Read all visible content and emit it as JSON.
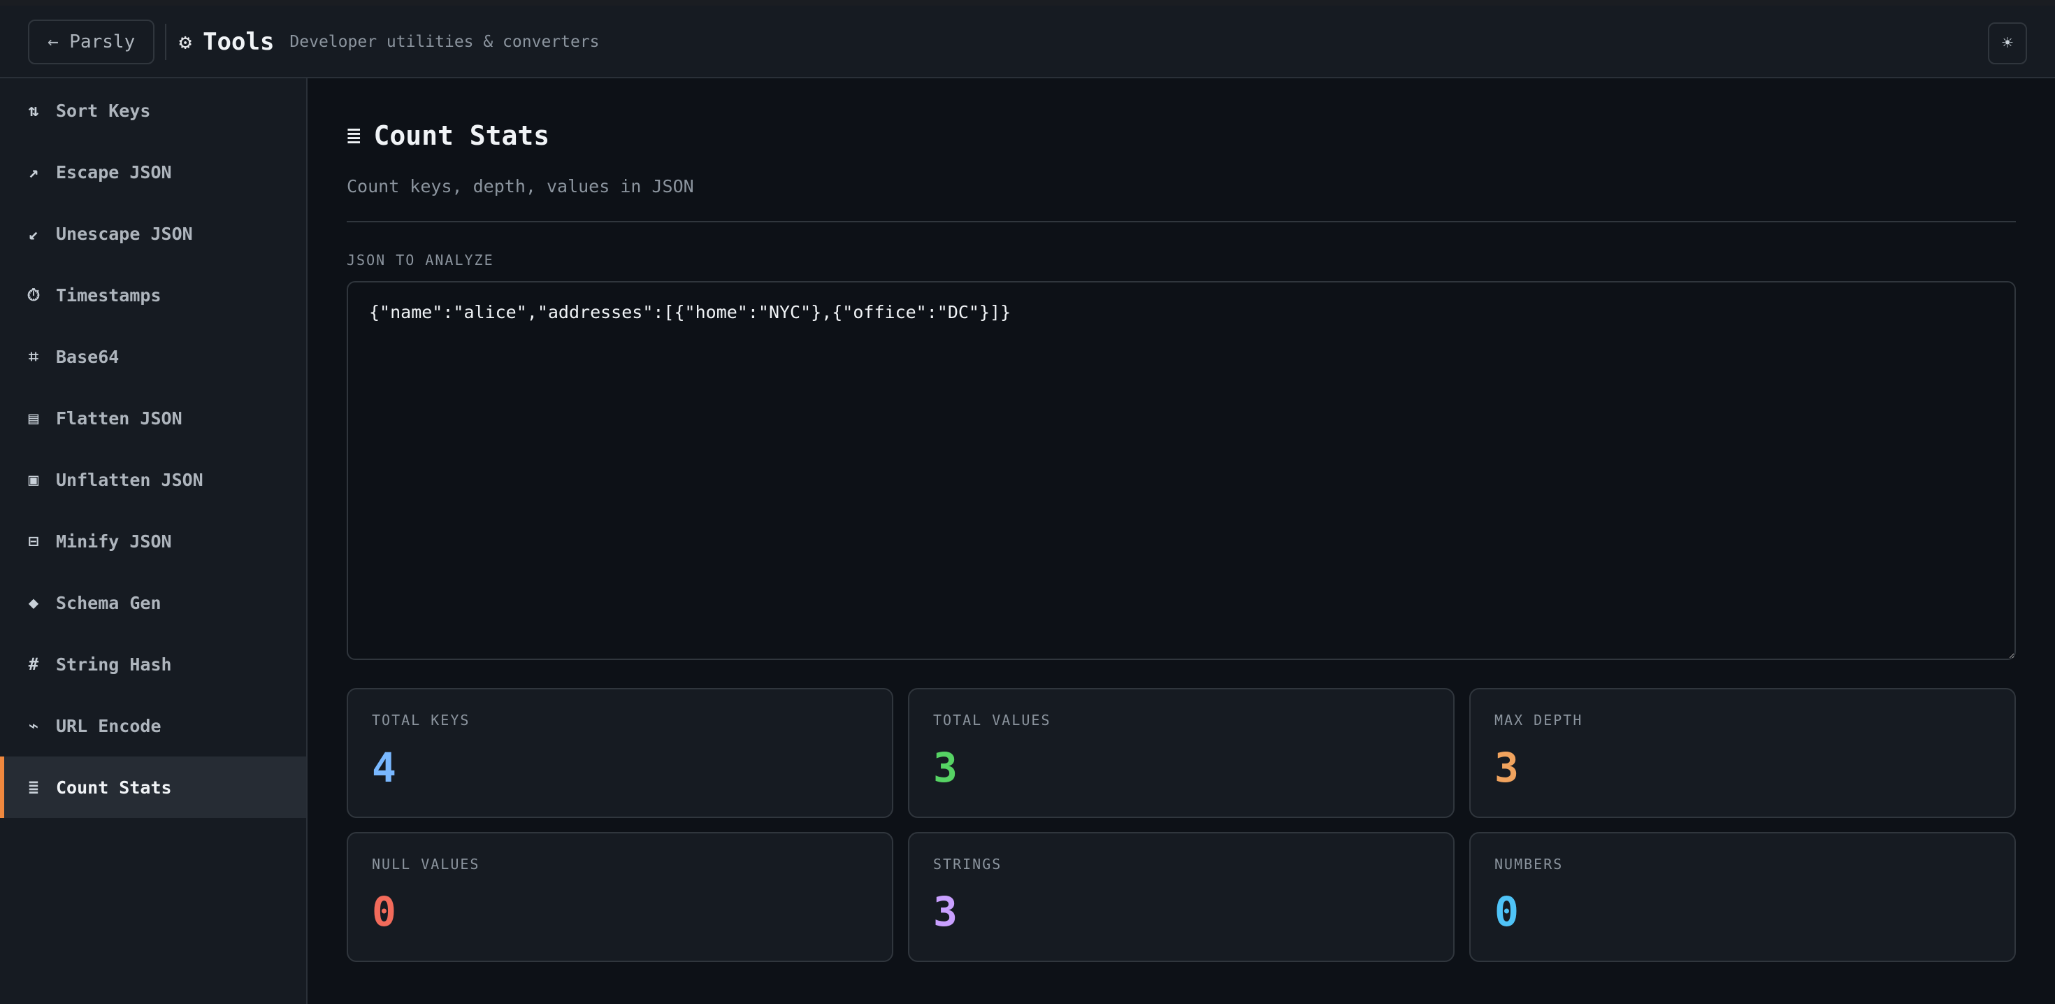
{
  "header": {
    "back_label": "← Parsly",
    "brand_icon": "gear-icon",
    "title": "Tools",
    "subtitle": "Developer utilities & converters",
    "theme_toggle_icon": "☀"
  },
  "sidebar": {
    "items": [
      {
        "icon": "⇅",
        "icon_name": "sort-icon",
        "label": "Sort Keys"
      },
      {
        "icon": "↗",
        "icon_name": "arrow-up-right-icon",
        "label": "Escape JSON"
      },
      {
        "icon": "↙",
        "icon_name": "arrow-down-left-icon",
        "label": "Unescape JSON"
      },
      {
        "icon": "⏱",
        "icon_name": "stopwatch-icon",
        "label": "Timestamps"
      },
      {
        "icon": "⌗",
        "icon_name": "hash-grid-icon",
        "label": "Base64"
      },
      {
        "icon": "▤",
        "icon_name": "flatten-icon",
        "label": "Flatten JSON"
      },
      {
        "icon": "▣",
        "icon_name": "unflatten-icon",
        "label": "Unflatten JSON"
      },
      {
        "icon": "⊟",
        "icon_name": "minify-icon",
        "label": "Minify JSON"
      },
      {
        "icon": "◆",
        "icon_name": "diamond-icon",
        "label": "Schema Gen"
      },
      {
        "icon": "#",
        "icon_name": "hash-icon",
        "label": "String Hash"
      },
      {
        "icon": "⌁",
        "icon_name": "link-icon",
        "label": "URL Encode"
      },
      {
        "icon": "≣",
        "icon_name": "list-icon",
        "label": "Count Stats"
      }
    ],
    "active_index": 11
  },
  "main": {
    "title_icon": "≣",
    "title": "Count Stats",
    "description": "Count keys, depth, values in JSON",
    "input_label": "JSON TO ANALYZE",
    "input_value": "{\"name\":\"alice\",\"addresses\":[{\"home\":\"NYC\"},{\"office\":\"DC\"}]}",
    "stats": [
      {
        "label": "TOTAL KEYS",
        "value": "4",
        "color": "#79b8ff"
      },
      {
        "label": "TOTAL VALUES",
        "value": "3",
        "color": "#56d364"
      },
      {
        "label": "MAX DEPTH",
        "value": "3",
        "color": "#f0a35e"
      },
      {
        "label": "NULL VALUES",
        "value": "0",
        "color": "#f26b5b"
      },
      {
        "label": "STRINGS",
        "value": "3",
        "color": "#c9a0ff"
      },
      {
        "label": "NUMBERS",
        "value": "0",
        "color": "#4fc3f7"
      }
    ]
  }
}
